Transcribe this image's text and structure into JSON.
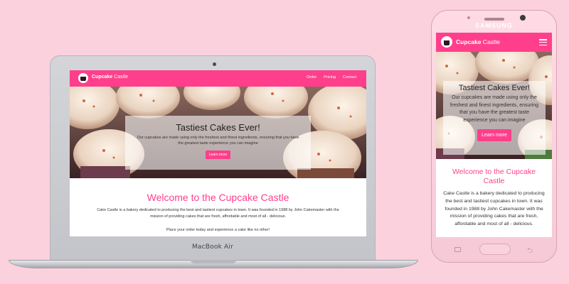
{
  "laptop": {
    "model_label": "MacBook Air",
    "site": {
      "brand_bold": "Cupcake",
      "brand_rest": " Castle",
      "nav": [
        "Order",
        "Pricing",
        "Contact"
      ],
      "hero_title": "Tastiest Cakes Ever!",
      "hero_text": "Our cupcakes are made using only the freshest and finest ingredients, ensuring that you have the greatest taste experience you can imagine",
      "hero_button": "Learn more",
      "welcome": "Welcome to the Cupcake Castle",
      "about": "Cake Castle is a bakery dedicated to producing the best and tastiest cupcakes in town. It was founded in 1988 by John Cakemaster with the mission of providing cakes that are fresh, affordable and most of all - delicious.",
      "order_text": "Place your order today and experience a cake like no other!"
    }
  },
  "phone": {
    "brand_label": "SAMSUNG",
    "site": {
      "brand_bold": "Cupcake",
      "brand_rest": " Castle",
      "hero_title": "Tastiest Cakes Ever!",
      "hero_text": "Our cupcakes are made using only the freshest and finest ingredients, ensuring that you have the greatest taste experience you can imagine",
      "hero_button": "Learn more",
      "welcome": "Welcome to the Cupcake Castle",
      "about": "Cake Castle is a bakery dedicated to producing the best and tastiest cupcakes in town. It was founded in 1988 by John Cakemaster with the mission of providing cakes that are fresh, affordable and most of all - delicious."
    }
  },
  "colors": {
    "background": "#fbd1dd",
    "brand_pink": "#ff3f8b"
  },
  "icons": [
    "cupcake-logo-icon",
    "hamburger-menu-icon",
    "recent-apps-icon",
    "back-icon"
  ]
}
